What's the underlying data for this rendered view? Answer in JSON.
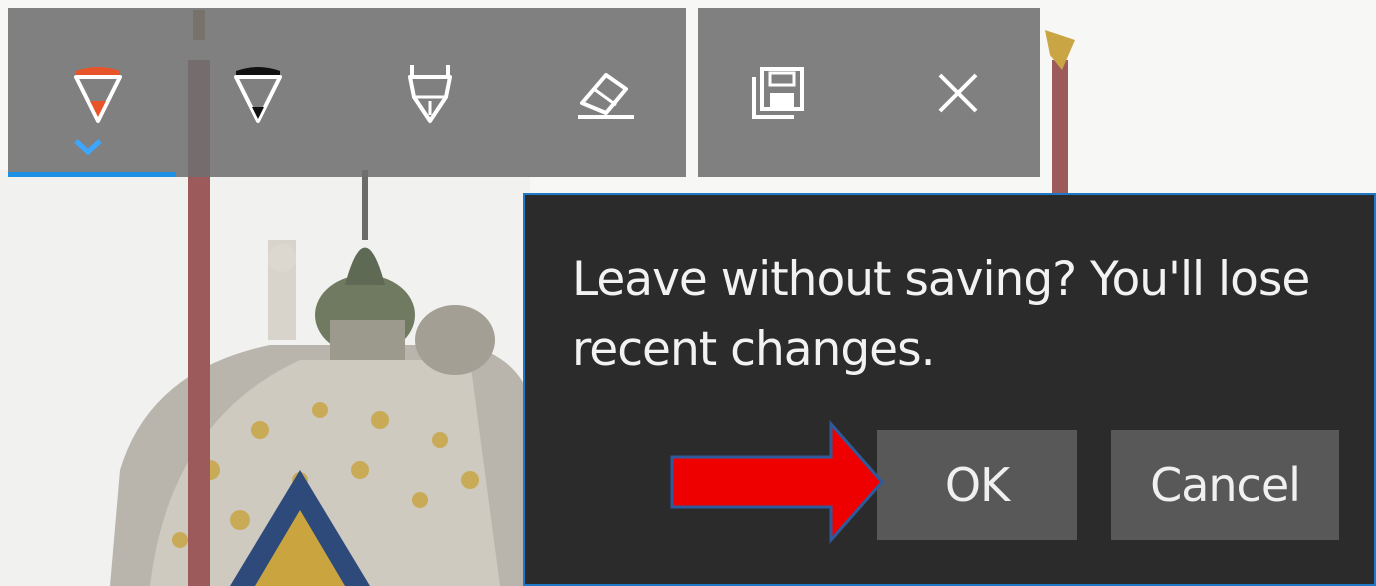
{
  "toolbar": {
    "pen_tools": [
      {
        "icon": "ballpoint-pen-icon",
        "selected": true,
        "ink_color": "#e8542a"
      },
      {
        "icon": "pencil-icon",
        "selected": false,
        "ink_color": "#111111"
      },
      {
        "icon": "highlighter-pen-icon",
        "selected": false
      },
      {
        "icon": "eraser-icon",
        "selected": false
      }
    ],
    "actions": [
      {
        "icon": "save-icon"
      },
      {
        "icon": "close-icon"
      }
    ],
    "accent_color": "#1e90e6"
  },
  "dialog": {
    "message": "Leave without saving? You'll lose recent changes.",
    "ok_label": "OK",
    "cancel_label": "Cancel",
    "background": "#2b2b2b",
    "border_color": "#1f78c8"
  },
  "annotation": {
    "arrow_color": "#ee0000",
    "points_to": "ok-button"
  }
}
